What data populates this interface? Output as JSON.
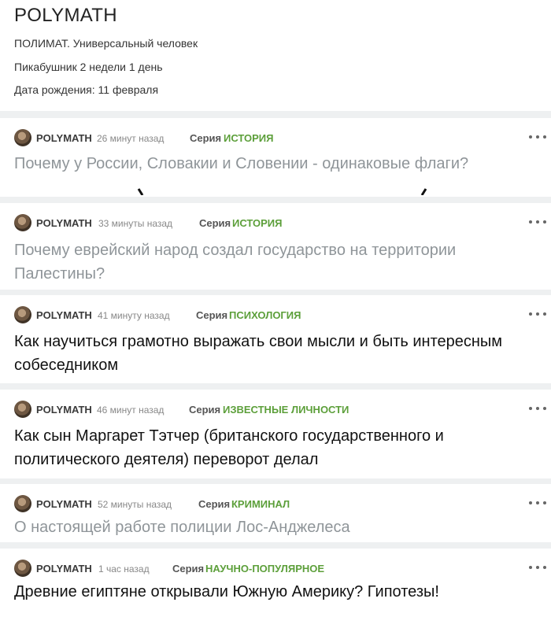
{
  "profile": {
    "name": "POLYMATH",
    "description": "ПОЛИМАТ. Универсальный человек",
    "tenure": "Пикабушник 2 недели 1 день",
    "birthday": "Дата рождения: 11 февраля"
  },
  "series_label": "Серия",
  "posts": [
    {
      "author": "POLYMATH",
      "time": "26 минут назад",
      "series": "ИСТОРИЯ",
      "title": "Почему у России, Словакии и Словении - одинаковые флаги?"
    },
    {
      "author": "POLYMATH",
      "time": "33 минуты назад",
      "series": "ИСТОРИЯ",
      "title": "Почему еврейский народ создал государство на территории Палестины?"
    },
    {
      "author": "POLYMATH",
      "time": "41 минуту назад",
      "series": "ПСИХОЛОГИЯ",
      "title": "Как научиться грамотно выражать свои мысли и быть интересным собеседником"
    },
    {
      "author": "POLYMATH",
      "time": "46 минут назад",
      "series": "ИЗВЕСТНЫЕ ЛИЧНОСТИ",
      "title": "Как сын Маргарет Тэтчер (британского государственного и политического деятеля) переворот делал"
    },
    {
      "author": "POLYMATH",
      "time": "52 минуты назад",
      "series": "КРИМИНАЛ",
      "title": "О настоящей работе полиции Лос-Анджелеса"
    },
    {
      "author": "POLYMATH",
      "time": "1 час назад",
      "series": "НАУЧНО-ПОПУЛЯРНОЕ",
      "title": "Древние египтяне открывали Южную Америку? Гипотезы!"
    }
  ],
  "colors": {
    "series_accent": "#5c9f3a",
    "visited_title": "#8f9599",
    "title": "#111111"
  },
  "icons": {
    "menu": "more-dots-icon",
    "avatar": "user-avatar"
  }
}
